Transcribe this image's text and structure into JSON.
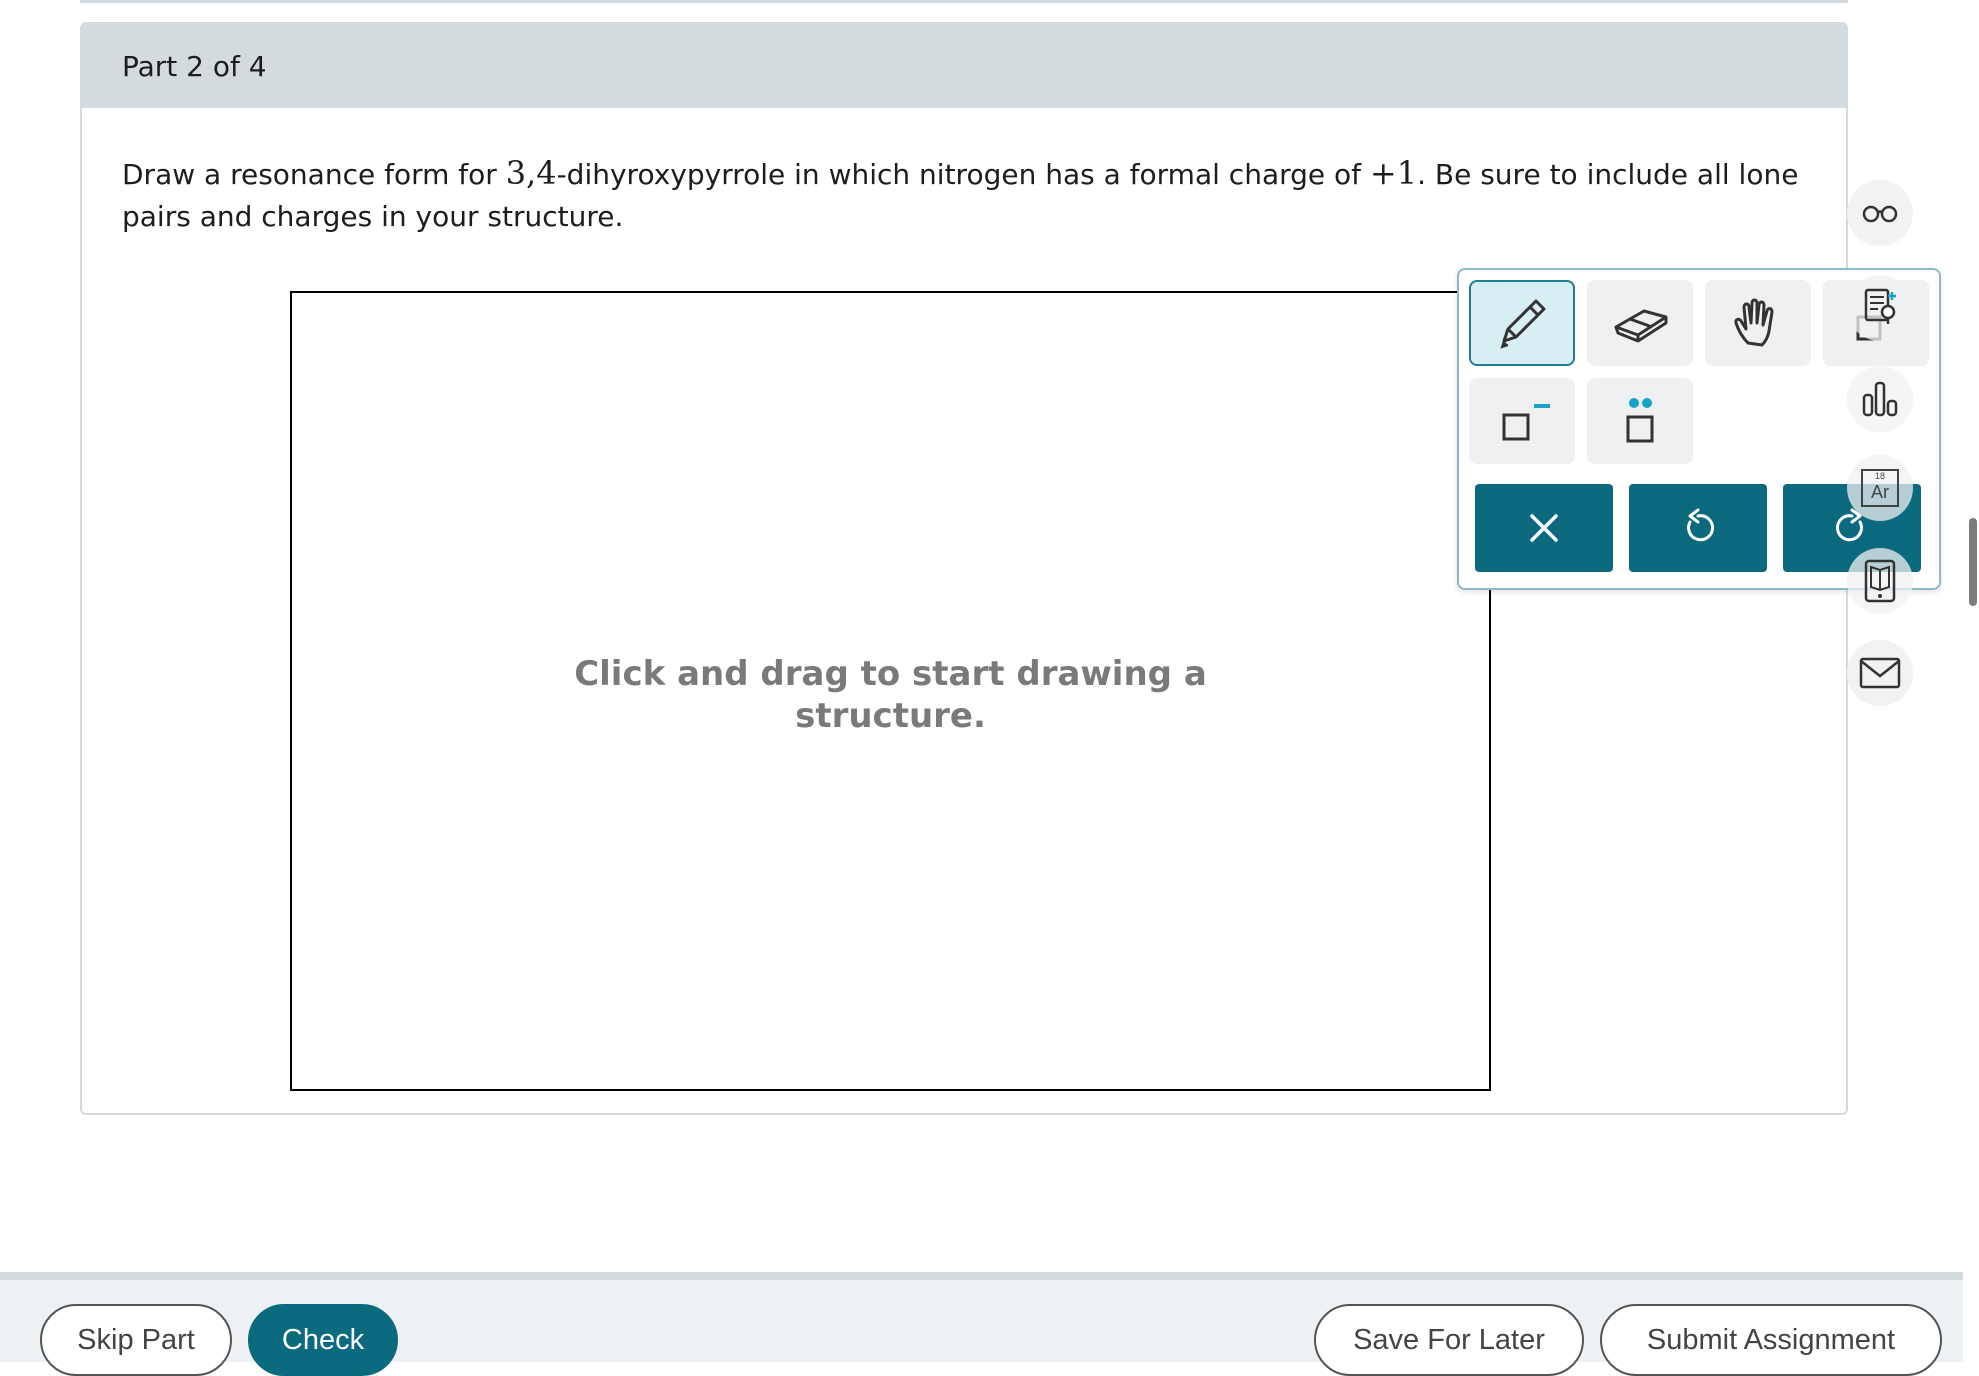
{
  "part": {
    "label": "Part 2 of 4"
  },
  "question": {
    "text_1": "Draw a resonance form for ",
    "compound_number": "3,4",
    "text_2": "-dihyroxypyrrole in which nitrogen has a formal charge of ",
    "charge": "+1",
    "text_3": ". Be sure to include all lone pairs and charges in your structure."
  },
  "canvas": {
    "hint_line_1": "Click and drag to start drawing a",
    "hint_line_2": "structure."
  },
  "toolbar": {
    "tools": [
      {
        "name": "pencil-icon",
        "selected": true
      },
      {
        "name": "eraser-icon",
        "selected": false
      },
      {
        "name": "hand-icon",
        "selected": false
      },
      {
        "name": "template-icon",
        "selected": false
      },
      {
        "name": "charge-icon",
        "selected": false
      },
      {
        "name": "lone-pair-icon",
        "selected": false
      }
    ],
    "actions": [
      "clear-icon",
      "undo-icon",
      "redo-icon"
    ]
  },
  "side_tools": [
    "reading-glasses-icon",
    "hint-icon",
    "bar-chart-icon",
    "periodic-table-icon",
    "ebook-icon",
    "mail-icon"
  ],
  "periodic_tile": {
    "number": "18",
    "symbol": "Ar"
  },
  "footer": {
    "skip_label": "Skip Part",
    "check_label": "Check",
    "save_label": "Save For Later",
    "submit_label": "Submit Assignment"
  },
  "colors": {
    "accent": "#0b6a7e",
    "header_bg": "#d3dbdf",
    "selected_tool_bg": "#d7eff3",
    "highlight": "#17a2c8"
  }
}
